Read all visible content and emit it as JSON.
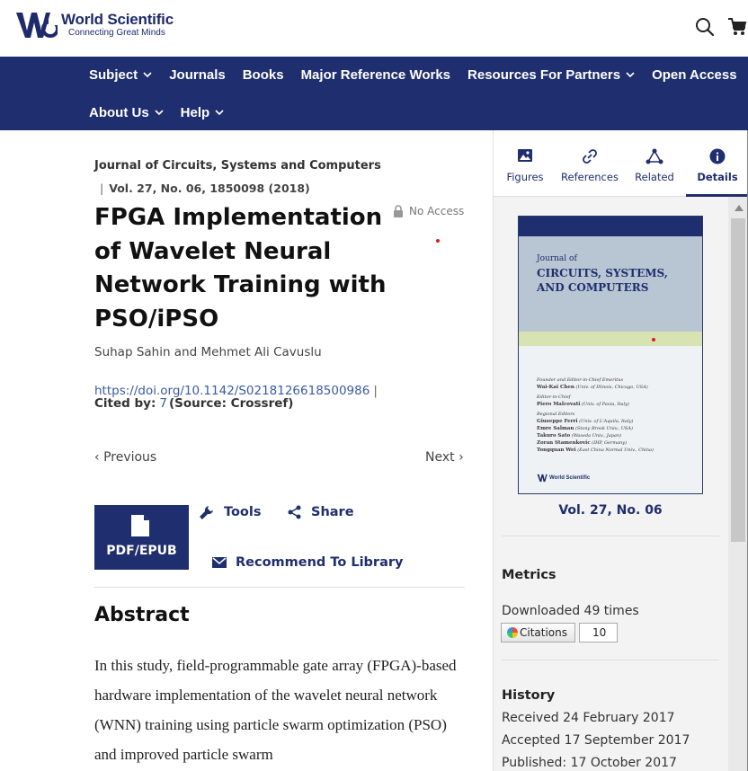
{
  "header": {
    "logo_title": "World Scientific",
    "logo_tagline": "Connecting Great Minds"
  },
  "nav": {
    "row1": [
      {
        "label": "Subject",
        "has_dropdown": true
      },
      {
        "label": "Journals",
        "has_dropdown": false
      },
      {
        "label": "Books",
        "has_dropdown": false
      },
      {
        "label": "Major Reference Works",
        "has_dropdown": false
      },
      {
        "label": "Resources For Partners",
        "has_dropdown": true
      },
      {
        "label": "Open Access",
        "has_dropdown": false
      }
    ],
    "row2": [
      {
        "label": "About Us",
        "has_dropdown": true
      },
      {
        "label": "Help",
        "has_dropdown": true
      }
    ]
  },
  "article": {
    "journal": "Journal of Circuits, Systems and Computers",
    "volume_line": "Vol. 27, No. 06, 1850098 (2018)",
    "title": "FPGA Implementation of Wavelet Neural Network Training with PSO/iPSO",
    "access": "No Access",
    "authors": "Suhap Sahin and Mehmet Ali Cavuslu",
    "doi": "https://doi.org/10.1142/S0218126618500986",
    "cited_label": "Cited by:",
    "cited_count": "7",
    "cited_source": "(Source: Crossref)",
    "prev": "Previous",
    "next": "Next",
    "pdf_label": "PDF/EPUB",
    "tools_label": "Tools",
    "share_label": "Share",
    "recommend_label": "Recommend To Library",
    "abstract_heading": "Abstract",
    "abstract_text": "In this study, field-programmable gate array (FPGA)-based hardware implementation of the wavelet neural network (WNN) training using particle swarm optimization (PSO) and improved particle swarm"
  },
  "sidebar": {
    "tabs": [
      {
        "label": "Figures",
        "icon": "image-icon"
      },
      {
        "label": "References",
        "icon": "link-icon"
      },
      {
        "label": "Related",
        "icon": "network-icon"
      },
      {
        "label": "Details",
        "icon": "info-icon",
        "active": true
      }
    ],
    "cover": {
      "journal_of": "Journal of",
      "title": "CIRCUITS, SYSTEMS, AND COMPUTERS",
      "founder_label": "Founder and Editor-in-Chief Emeritus",
      "founder": "Wai-Kai Chen",
      "founder_aff": "(Univ. of Illinois, Chicago, USA)",
      "eic_label": "Editor-in-Chief",
      "eic": "Piero Malcovati",
      "eic_aff": "(Univ. of Pavia, Italy)",
      "regional_label": "Regional Editors",
      "regional": [
        {
          "name": "Giuseppe Ferri",
          "aff": "(Univ. of L'Aquila, Italy)"
        },
        {
          "name": "Emre Salman",
          "aff": "(Stony Brook Univ., USA)"
        },
        {
          "name": "Takuro Sato",
          "aff": "(Waseda Univ., Japan)"
        },
        {
          "name": "Zoran Stamenkovic",
          "aff": "(IHP, Germany)"
        },
        {
          "name": "Tongquan Wei",
          "aff": "(East China Normal Univ., China)"
        }
      ],
      "publisher": "World Scientific"
    },
    "volume": "Vol. 27, No. 06",
    "metrics_heading": "Metrics",
    "downloads": "Downloaded 49 times",
    "citations_label": "Citations",
    "citations_count": "10",
    "history_heading": "History",
    "history": [
      "Received 24 February 2017",
      "Accepted 17 September 2017",
      "Published: 17 October 2017"
    ]
  },
  "colors": {
    "brand_navy": "#1f2e6e",
    "link_blue": "#3a5aa8",
    "sidebar_bg": "#f3f3f3"
  }
}
